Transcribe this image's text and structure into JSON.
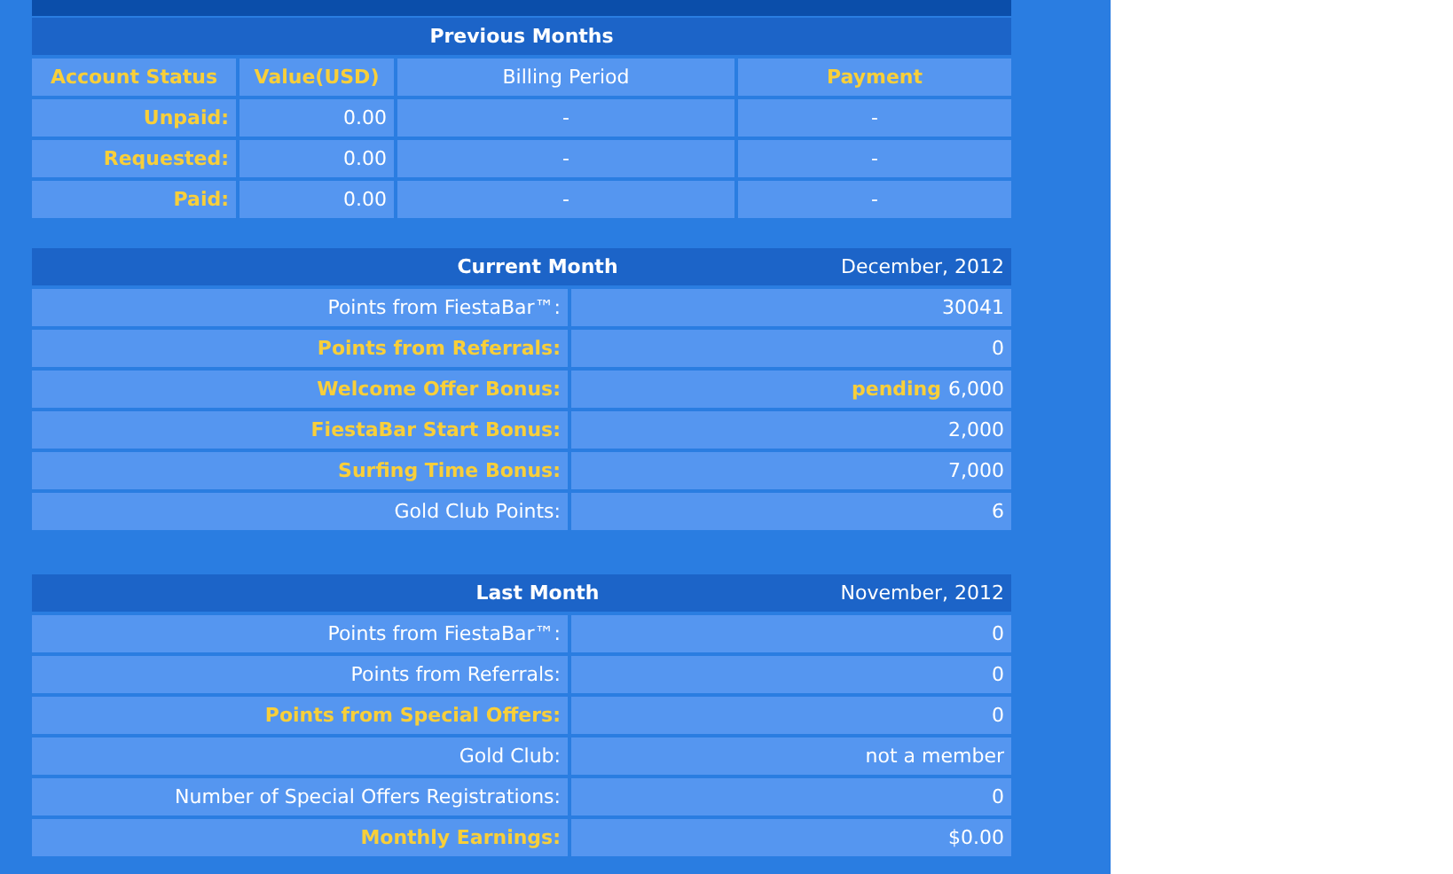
{
  "previous_months": {
    "title": "Previous Months",
    "columns": [
      {
        "label": "Account Status",
        "highlight": true
      },
      {
        "label": "Value(USD)",
        "highlight": true
      },
      {
        "label": "Billing Period",
        "highlight": false
      },
      {
        "label": "Payment",
        "highlight": true
      }
    ],
    "rows": [
      {
        "status": "Unpaid:",
        "value": "0.00",
        "billing_period": "-",
        "payment": "-"
      },
      {
        "status": "Requested:",
        "value": "0.00",
        "billing_period": "-",
        "payment": "-"
      },
      {
        "status": "Paid:",
        "value": "0.00",
        "billing_period": "-",
        "payment": "-"
      }
    ]
  },
  "months": [
    {
      "title": "Current Month",
      "period": "December, 2012",
      "rows": [
        {
          "label": "Points from FiestaBar™:",
          "highlight": false,
          "value": "30041"
        },
        {
          "label": "Points from Referrals:",
          "highlight": true,
          "value": "0"
        },
        {
          "label": "Welcome Offer Bonus:",
          "highlight": true,
          "note": "pending",
          "value": "6,000"
        },
        {
          "label": "FiestaBar Start Bonus:",
          "highlight": true,
          "value": "2,000"
        },
        {
          "label": "Surfing Time Bonus:",
          "highlight": true,
          "value": "7,000"
        },
        {
          "label": "Gold Club Points:",
          "highlight": false,
          "value": "6"
        }
      ]
    },
    {
      "title": "Last Month",
      "period": "November, 2012",
      "rows": [
        {
          "label": "Points from FiestaBar™:",
          "highlight": false,
          "value": "0"
        },
        {
          "label": "Points from Referrals:",
          "highlight": false,
          "value": "0"
        },
        {
          "label": "Points from Special Offers:",
          "highlight": true,
          "value": "0"
        },
        {
          "label": "Gold Club:",
          "highlight": false,
          "value": "not a member"
        },
        {
          "label": "Number of Special Offers Registrations:",
          "highlight": false,
          "value": "0"
        },
        {
          "label": "Monthly Earnings:",
          "highlight": true,
          "value": "$0.00"
        }
      ]
    }
  ]
}
